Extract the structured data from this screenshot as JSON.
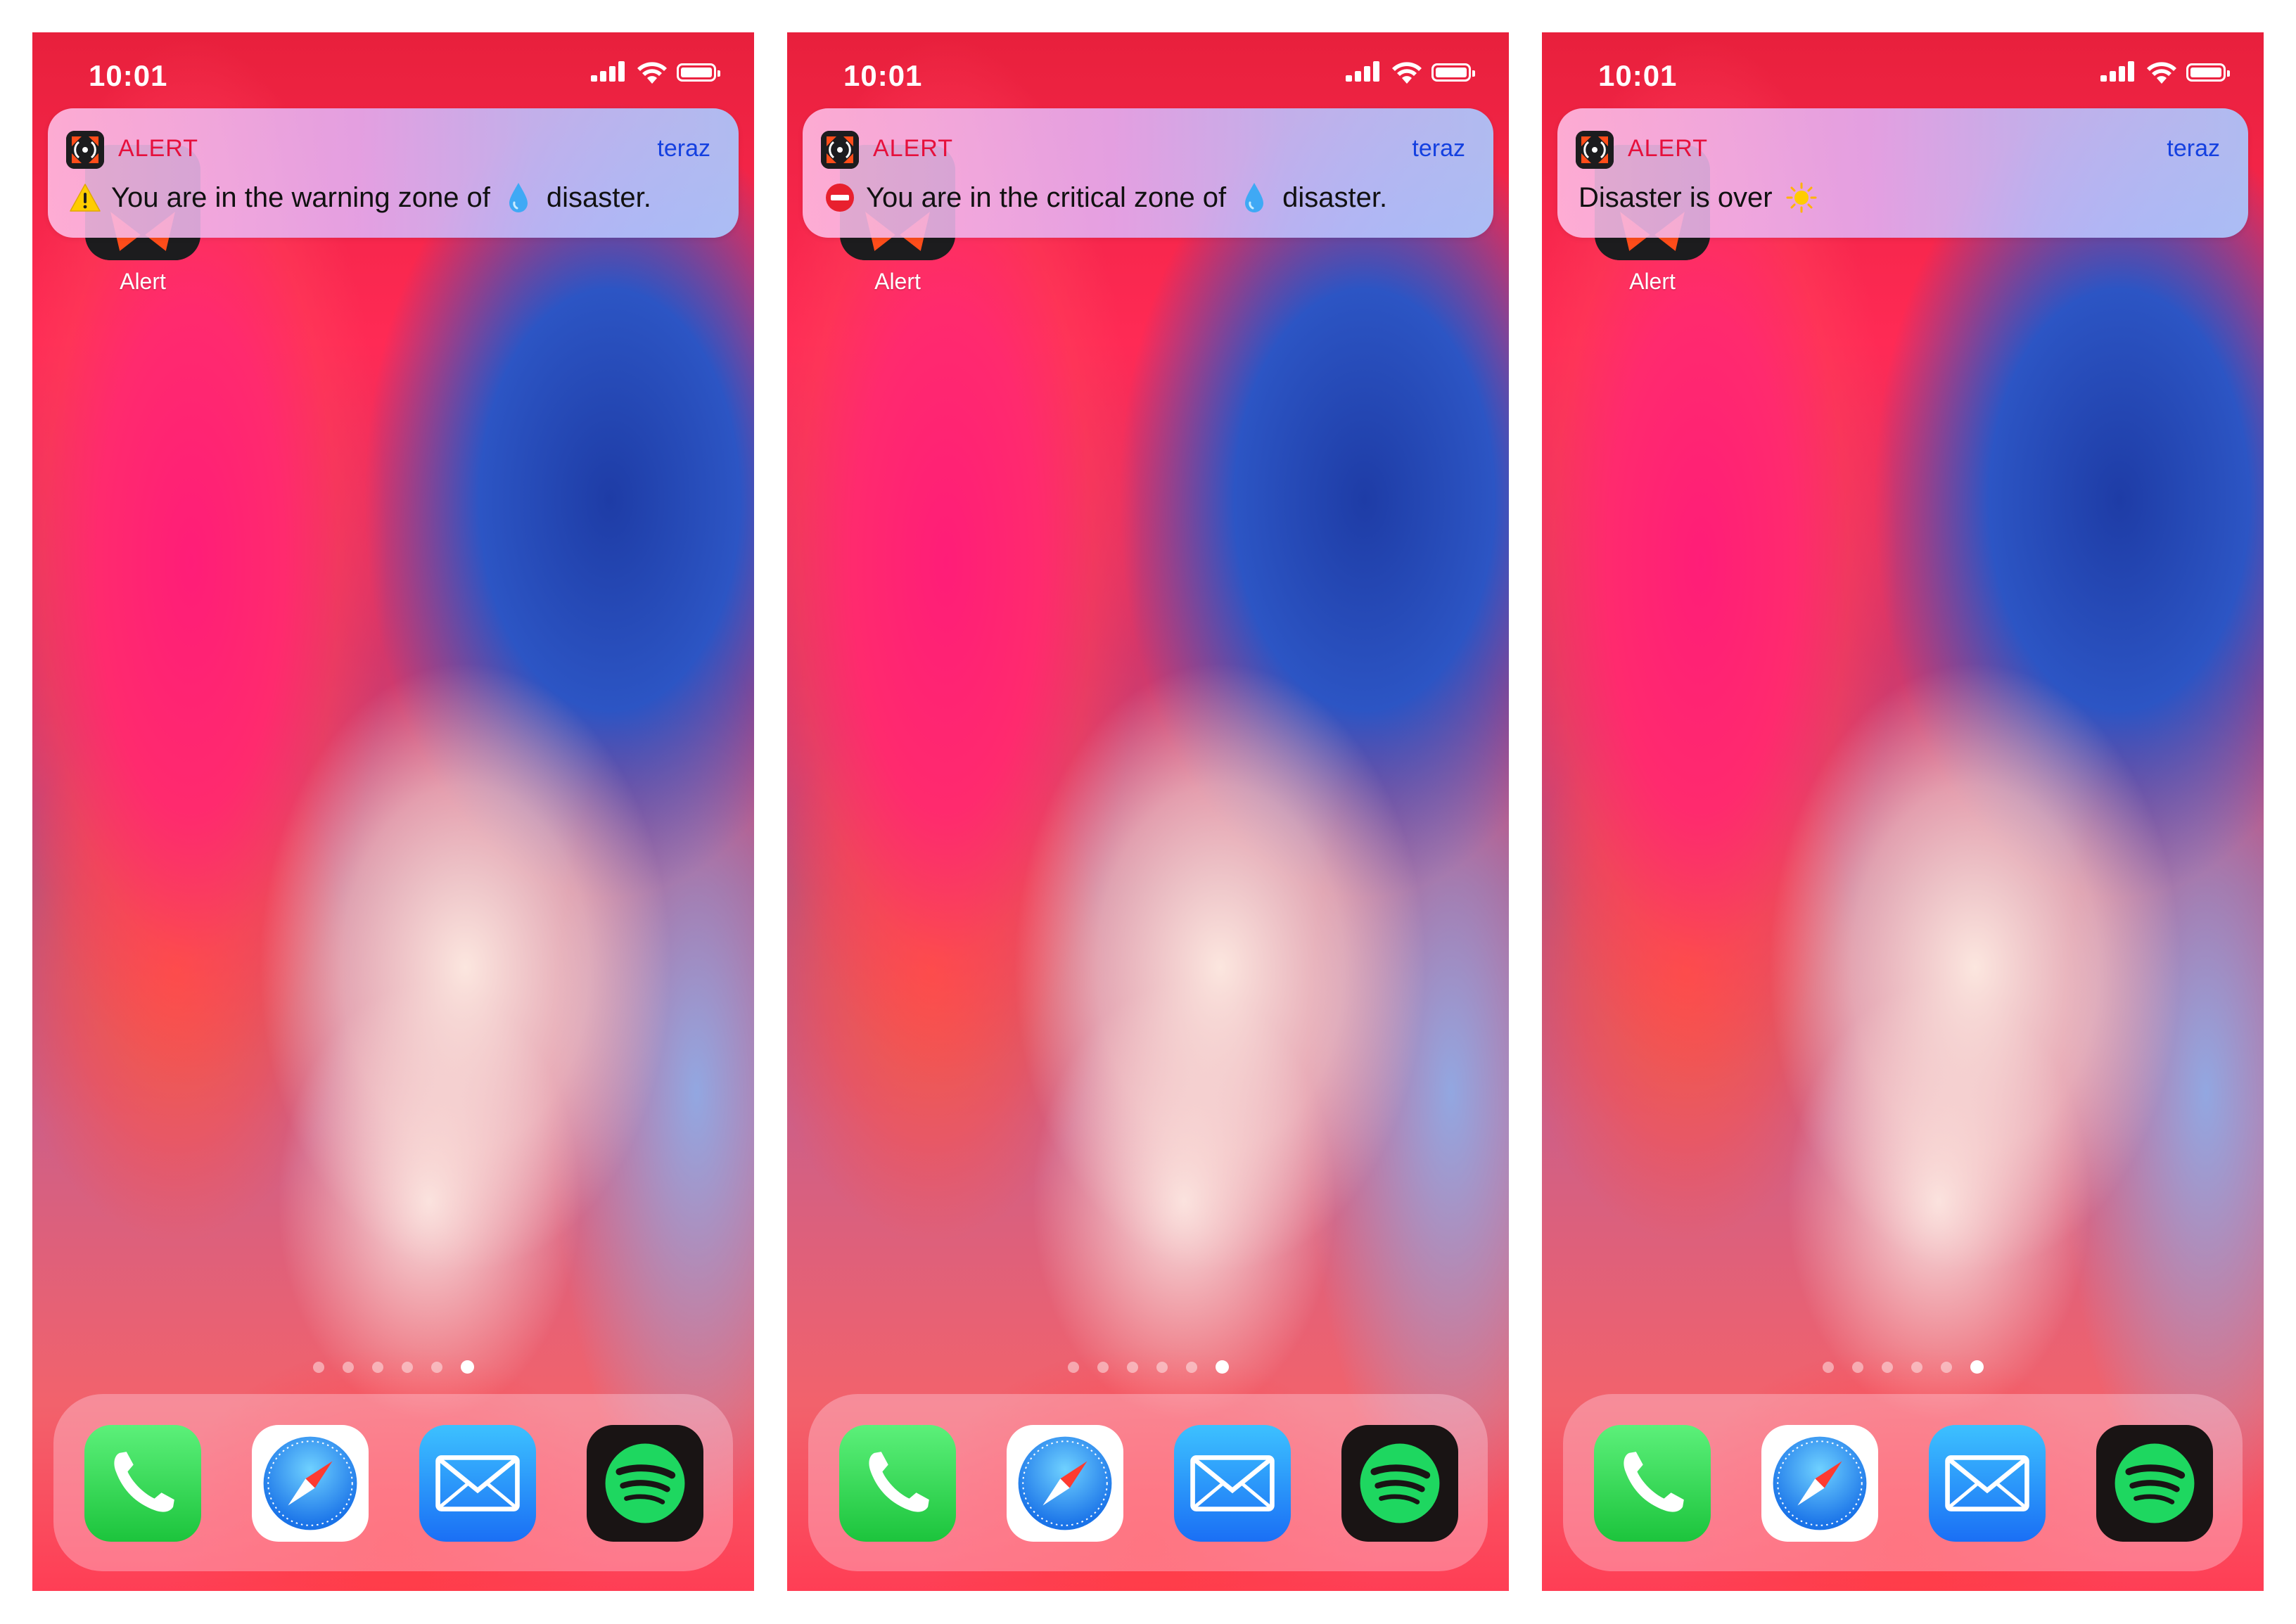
{
  "screens": [
    {
      "status": {
        "time": "10:01"
      },
      "notification": {
        "app_name": "ALERT",
        "time": "teraz",
        "prefix_icon": "warning-sign",
        "text_before": "You are in the warning zone of",
        "inline_icon": "droplet",
        "text_after": "disaster.",
        "suffix_icon": ""
      },
      "home_app": {
        "label": "Alert"
      },
      "page_dots": {
        "count": 6,
        "active_index": 5
      },
      "dock": [
        "phone-icon",
        "safari-icon",
        "mail-icon",
        "spotify-icon"
      ]
    },
    {
      "status": {
        "time": "10:01"
      },
      "notification": {
        "app_name": "ALERT",
        "time": "teraz",
        "prefix_icon": "no-entry",
        "text_before": "You are in the critical zone of",
        "inline_icon": "droplet",
        "text_after": "disaster.",
        "suffix_icon": ""
      },
      "home_app": {
        "label": "Alert"
      },
      "page_dots": {
        "count": 6,
        "active_index": 5
      },
      "dock": [
        "phone-icon",
        "safari-icon",
        "mail-icon",
        "spotify-icon"
      ]
    },
    {
      "status": {
        "time": "10:01"
      },
      "notification": {
        "app_name": "ALERT",
        "time": "teraz",
        "prefix_icon": "",
        "text_before": "Disaster is over",
        "inline_icon": "",
        "text_after": "",
        "suffix_icon": "sun"
      },
      "home_app": {
        "label": "Alert"
      },
      "page_dots": {
        "count": 6,
        "active_index": 5
      },
      "dock": [
        "phone-icon",
        "safari-icon",
        "mail-icon",
        "spotify-icon"
      ]
    }
  ],
  "colors": {
    "alert_red": "#e6103c",
    "time_blue": "#1440e0",
    "phone_green": "#34c759",
    "mail_blue": "#1e90ff",
    "spotify_green": "#1ed760"
  }
}
